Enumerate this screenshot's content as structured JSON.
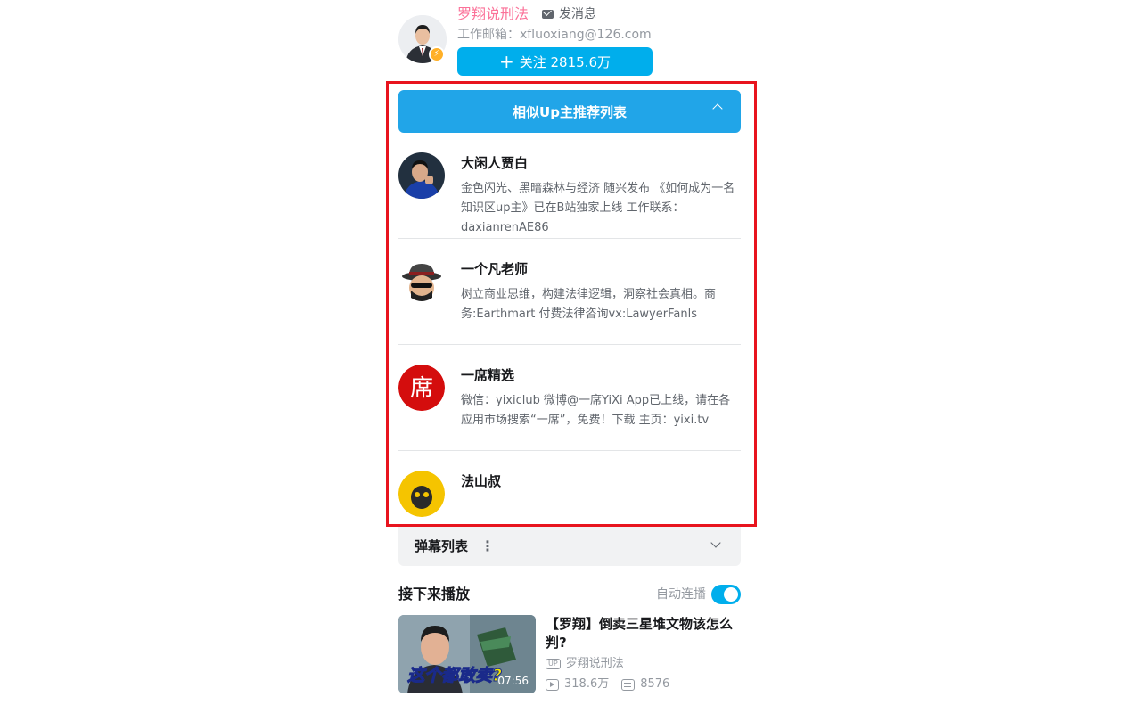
{
  "up": {
    "name": "罗翔说刑法",
    "message_label": "发消息",
    "description": "工作邮箱：xfluoxiang@126.com",
    "follow_label": "关注 2815.6万",
    "avatar_icon": "person-avatar-icon",
    "badge_icon": "lightning-badge-icon"
  },
  "recommend": {
    "title": "相似Up主推荐列表",
    "items": [
      {
        "name": "大闲人贾白",
        "description": "金色闪光、黑暗森林与经济 随兴发布 《如何成为一名知识区up主》已在B站独家上线 工作联系：daxianrenAE86"
      },
      {
        "name": "一个凡老师",
        "description": "树立商业思维，构建法律逻辑，洞察社会真相。商务:Earthmart 付费法律咨询vx:LawyerFanls"
      },
      {
        "name": "一席精选",
        "description": "微信：yixiclub 微博@一席YiXi App已上线，请在各应用市场搜索“一席”，免费！下载 主页：yixi.tv",
        "avatar_char": "席"
      },
      {
        "name": "法山叔",
        "description": ""
      }
    ]
  },
  "danmaku": {
    "label": "弹幕列表",
    "menu_glyph": "⋮"
  },
  "next": {
    "title": "接下来播放",
    "autoplay_label": "自动连播",
    "video": {
      "title": "【罗翔】倒卖三星堆文物该怎么判?",
      "up_tag": "UP",
      "up_name": "罗翔说刑法",
      "plays": "318.6万",
      "danmaku": "8576",
      "duration": "07:56",
      "thumb_caption": "这个都敢卖?"
    }
  },
  "colors": {
    "accent": "#00aeec",
    "up_name": "#fb7299",
    "highlight": "#e8141e"
  }
}
